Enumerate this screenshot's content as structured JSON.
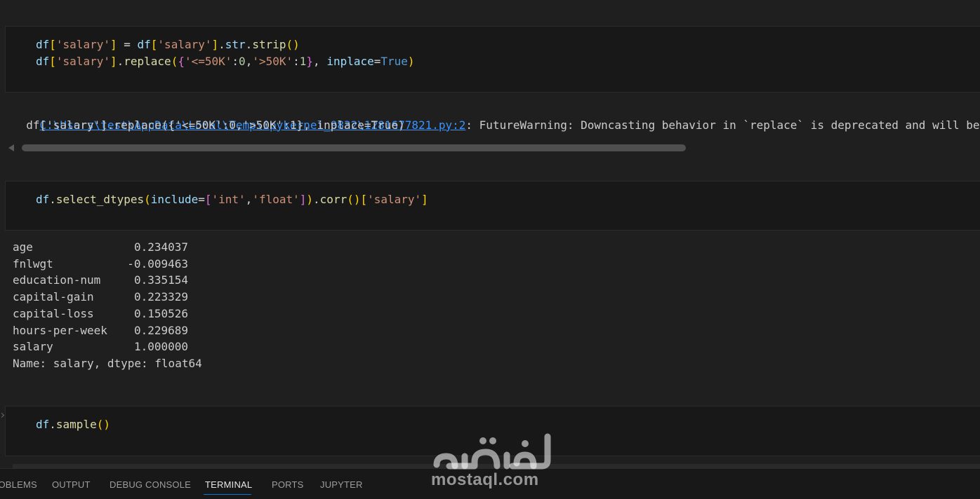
{
  "cells": [
    {
      "lines": [
        [
          {
            "t": "df",
            "c": "var"
          },
          {
            "t": "[",
            "c": "br1"
          },
          {
            "t": "'salary'",
            "c": "str"
          },
          {
            "t": "]",
            "c": "br1"
          },
          {
            "t": " = ",
            "c": "punc"
          },
          {
            "t": "df",
            "c": "var"
          },
          {
            "t": "[",
            "c": "br1"
          },
          {
            "t": "'salary'",
            "c": "str"
          },
          {
            "t": "]",
            "c": "br1"
          },
          {
            "t": ".",
            "c": "punc"
          },
          {
            "t": "str",
            "c": "var"
          },
          {
            "t": ".",
            "c": "punc"
          },
          {
            "t": "strip",
            "c": "fn"
          },
          {
            "t": "()",
            "c": "br1"
          }
        ],
        [
          {
            "t": "df",
            "c": "var"
          },
          {
            "t": "[",
            "c": "br1"
          },
          {
            "t": "'salary'",
            "c": "str"
          },
          {
            "t": "]",
            "c": "br1"
          },
          {
            "t": ".",
            "c": "punc"
          },
          {
            "t": "replace",
            "c": "fn"
          },
          {
            "t": "(",
            "c": "br1"
          },
          {
            "t": "{",
            "c": "br2"
          },
          {
            "t": "'<=50K'",
            "c": "str"
          },
          {
            "t": ":",
            "c": "punc"
          },
          {
            "t": "0",
            "c": "num"
          },
          {
            "t": ",",
            "c": "punc"
          },
          {
            "t": "'>50K'",
            "c": "str"
          },
          {
            "t": ":",
            "c": "punc"
          },
          {
            "t": "1",
            "c": "num"
          },
          {
            "t": "}",
            "c": "br2"
          },
          {
            "t": ", ",
            "c": "punc"
          },
          {
            "t": "inplace",
            "c": "var"
          },
          {
            "t": "=",
            "c": "punc"
          },
          {
            "t": "True",
            "c": "kw"
          },
          {
            "t": ")",
            "c": "br1"
          }
        ]
      ]
    },
    {
      "lines": [
        [
          {
            "t": "df",
            "c": "var"
          },
          {
            "t": ".",
            "c": "punc"
          },
          {
            "t": "select_dtypes",
            "c": "fn"
          },
          {
            "t": "(",
            "c": "br1"
          },
          {
            "t": "include",
            "c": "var"
          },
          {
            "t": "=",
            "c": "punc"
          },
          {
            "t": "[",
            "c": "br2"
          },
          {
            "t": "'int'",
            "c": "str"
          },
          {
            "t": ",",
            "c": "punc"
          },
          {
            "t": "'float'",
            "c": "str"
          },
          {
            "t": "]",
            "c": "br2"
          },
          {
            "t": ")",
            "c": "br1"
          },
          {
            "t": ".",
            "c": "punc"
          },
          {
            "t": "corr",
            "c": "fn"
          },
          {
            "t": "()",
            "c": "br1"
          },
          {
            "t": "[",
            "c": "br1"
          },
          {
            "t": "'salary'",
            "c": "str"
          },
          {
            "t": "]",
            "c": "br1"
          }
        ]
      ]
    },
    {
      "lines": [
        [
          {
            "t": "df",
            "c": "var"
          },
          {
            "t": ".",
            "c": "punc"
          },
          {
            "t": "sample",
            "c": "fn"
          },
          {
            "t": "()",
            "c": "br1"
          }
        ]
      ]
    }
  ],
  "warning": {
    "link": "C:\\Users\\test\\AppData\\Local\\Temp\\ipykernel_9832\\1281677821.py:2",
    "message": ": FutureWarning: Downcasting behavior in `replace` is deprecated and will be removed in a future version.",
    "source_line": "  df['salary'].replace({'<=50K':0,'>50K':1}, inplace=True)"
  },
  "corr_output": {
    "rows": [
      {
        "name": "age",
        "value": "0.234037"
      },
      {
        "name": "fnlwgt",
        "value": "-0.009463"
      },
      {
        "name": "education-num",
        "value": "0.335154"
      },
      {
        "name": "capital-gain",
        "value": "0.223329"
      },
      {
        "name": "capital-loss",
        "value": "0.150526"
      },
      {
        "name": "hours-per-week",
        "value": "0.229689"
      },
      {
        "name": "salary",
        "value": "1.000000"
      }
    ],
    "footer": "Name: salary, dtype: float64"
  },
  "panel_tabs": [
    {
      "label": "PROBLEMS",
      "active": false
    },
    {
      "label": "OUTPUT",
      "active": false
    },
    {
      "label": "DEBUG CONSOLE",
      "active": false
    },
    {
      "label": "TERMINAL",
      "active": true
    },
    {
      "label": "PORTS",
      "active": false
    },
    {
      "label": "JUPYTER",
      "active": false
    }
  ],
  "watermark": {
    "arabic": "مستقل",
    "latin": "mostaql.com"
  },
  "colors": {
    "background": "#1f1f1f",
    "cell_background": "#181818",
    "link": "#3794ff",
    "active_tab_underline": "#0078d4"
  }
}
